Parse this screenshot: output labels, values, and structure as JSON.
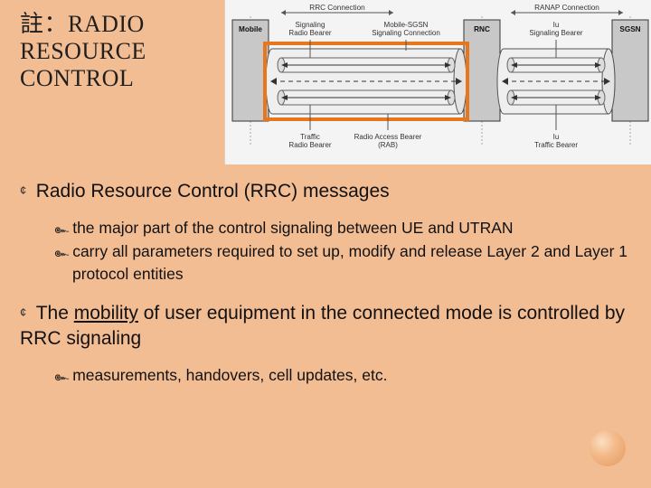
{
  "title": {
    "l1": "註：RADIO",
    "l2": "RESOURCE",
    "l3": "CONTROL"
  },
  "diagram": {
    "top_labels": {
      "rrc": "RRC Connection",
      "ranap": "RANAP Connection"
    },
    "nodes": {
      "mobile": "Mobile",
      "sig_rb": "Signaling\nRadio Bearer",
      "mobile_sgsn": "Mobile-SGSN\nSignaling Connection",
      "rnc": "RNC",
      "iu_sb": "Iu\nSignaling Bearer",
      "sgsn": "SGSN"
    },
    "bottom_labels": {
      "traffic_rb": "Traffic\nRadio Bearer",
      "rab": "Radio Access Bearer\n(RAB)",
      "iu_tb": "Iu\nTraffic Bearer"
    }
  },
  "bullets": {
    "b1": "Radio Resource Control (RRC) messages",
    "b1_sub1": "the major part of the control signaling between UE and UTRAN",
    "b1_sub2": "carry all parameters required to set up, modify and release Layer 2 and Layer 1 protocol entities",
    "b2_pre": "The ",
    "b2_u": "mobility",
    "b2_post": " of user equipment in the connected mode is controlled by RRC signaling",
    "b2_sub1": "measurements, handovers, cell updates, etc."
  },
  "glyphs": {
    "circle_bullet": "¢",
    "swirl": "๛"
  }
}
